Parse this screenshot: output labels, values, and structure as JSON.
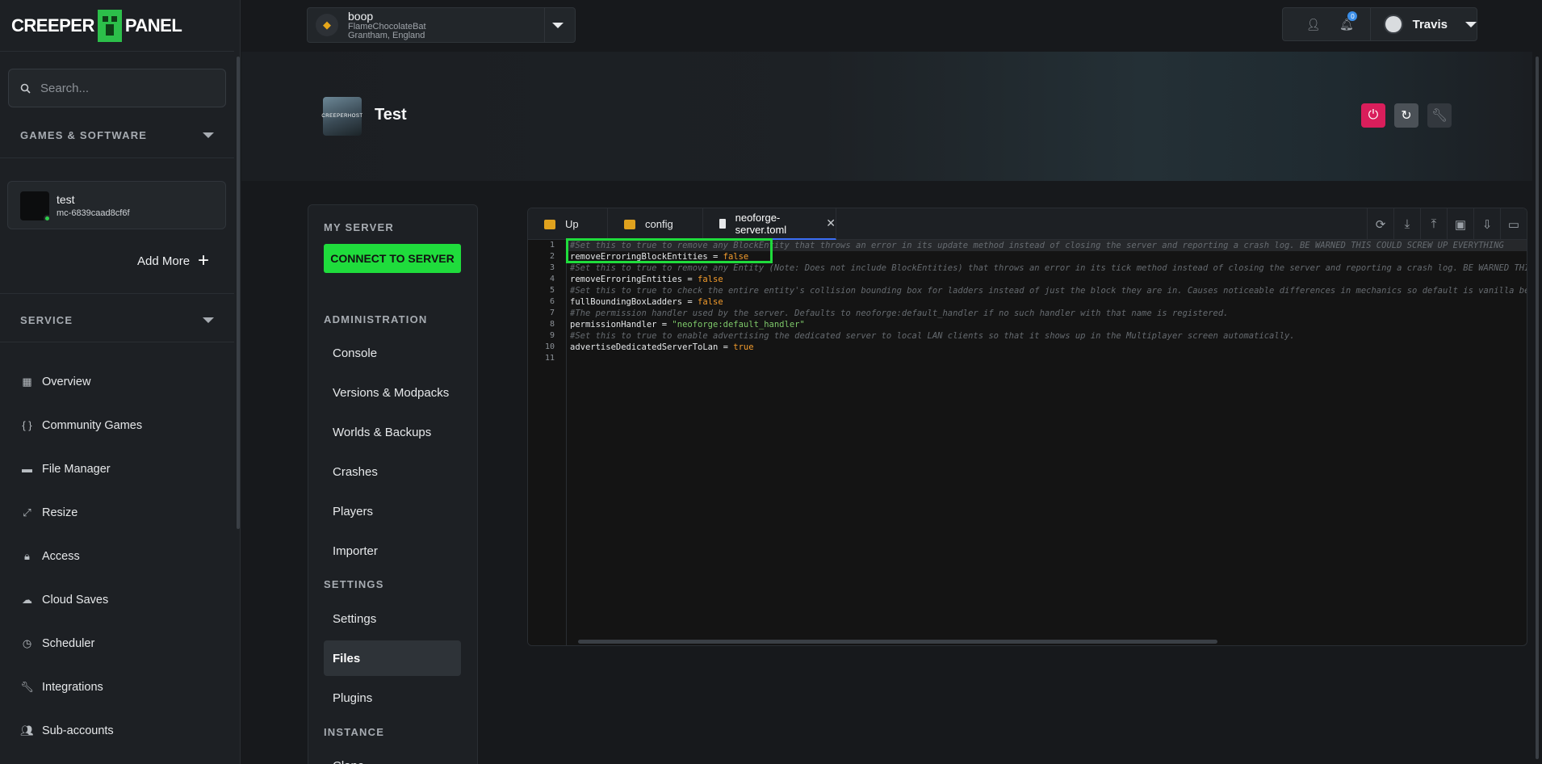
{
  "brand": {
    "left": "CREEPER",
    "right": "PANEL"
  },
  "sidebar": {
    "search_placeholder": "Search...",
    "games_heading": "GAMES & SOFTWARE",
    "server": {
      "name": "test",
      "id": "mc-6839caad8cf6f"
    },
    "add_more": "Add More",
    "service_heading": "SERVICE",
    "items": [
      {
        "label": "Overview",
        "icon": "grid-icon"
      },
      {
        "label": "Community Games",
        "icon": "braces-icon"
      },
      {
        "label": "File Manager",
        "icon": "folder-icon"
      },
      {
        "label": "Resize",
        "icon": "resize-icon"
      },
      {
        "label": "Access",
        "icon": "lock-icon"
      },
      {
        "label": "Cloud Saves",
        "icon": "cloud-icon"
      },
      {
        "label": "Scheduler",
        "icon": "clock-icon"
      },
      {
        "label": "Integrations",
        "icon": "wrench-icon"
      },
      {
        "label": "Sub-accounts",
        "icon": "users-icon"
      }
    ]
  },
  "topbar": {
    "server_name": "boop",
    "server_host": "FlameChocolateBat",
    "server_location": "Grantham, England",
    "notification_count": "0",
    "user_name": "Travis"
  },
  "hero": {
    "title": "Test",
    "icon_text": "CREEPERHOST"
  },
  "menu": {
    "my_server": "MY SERVER",
    "connect": "CONNECT TO SERVER",
    "administration": "ADMINISTRATION",
    "admin_items": [
      "Console",
      "Versions & Modpacks",
      "Worlds & Backups",
      "Crashes",
      "Players",
      "Importer"
    ],
    "settings_heading": "SETTINGS",
    "settings_items": [
      "Settings",
      "Files",
      "Plugins"
    ],
    "instance_heading": "INSTANCE",
    "instance_items": [
      "Clone"
    ]
  },
  "editor": {
    "tabs": [
      "Up",
      "config",
      "neoforge-server.toml"
    ],
    "lines": [
      "#Set this to true to remove any BlockEntity that throws an error in its update method instead of closing the server and reporting a crash log. BE WARNED THIS COULD SCREW UP EVERYTHING",
      "removeErroringBlockEntities = false",
      "#Set this to true to remove any Entity (Note: Does not include BlockEntities) that throws an error in its tick method instead of closing the server and reporting a crash log. BE WARNED THIS COULD SCREW UP EVERYTHING",
      "removeErroringEntities = false",
      "#Set this to true to check the entire entity's collision bounding box for ladders instead of just the block they are in. Causes noticeable differences in mechanics so default is vanilla behavior. Default: false.",
      "fullBoundingBoxLadders = false",
      "#The permission handler used by the server. Defaults to neoforge:default_handler if no such handler with that name is registered.",
      "permissionHandler = \"neoforge:default_handler\"",
      "#Set this to true to enable advertising the dedicated server to local LAN clients so that it shows up in the Multiplayer screen automatically.",
      "advertiseDedicatedServerToLan = true",
      ""
    ]
  },
  "colors": {
    "accent_green": "#1fdc3c",
    "power_red": "#d91e5b",
    "tab_underline": "#3b6ef5",
    "folder": "#e0a21e"
  }
}
